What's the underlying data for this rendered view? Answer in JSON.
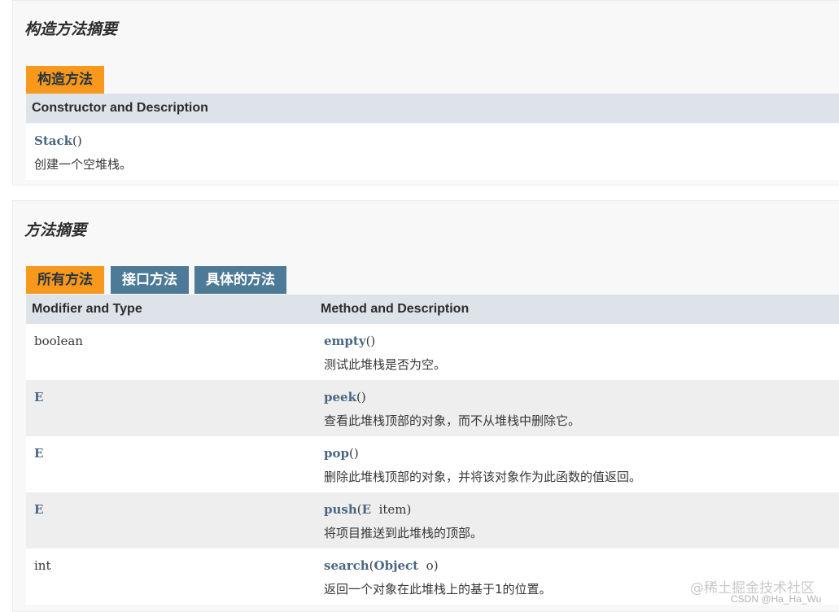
{
  "constructor_summary": {
    "title": "构造方法摘要",
    "tab_label": "构造方法",
    "header": "Constructor and Description",
    "rows": [
      {
        "name": "Stack",
        "params": "()",
        "description": "创建一个空堆栈。"
      }
    ]
  },
  "method_summary": {
    "title": "方法摘要",
    "tabs": [
      {
        "label": "所有方法",
        "active": true
      },
      {
        "label": "接口方法",
        "active": false
      },
      {
        "label": "具体的方法",
        "active": false
      }
    ],
    "headers": {
      "modifier_type": "Modifier and Type",
      "method_description": "Method and Description"
    },
    "rows": [
      {
        "type": "boolean",
        "name": "empty",
        "open": "(",
        "param_type": "",
        "param_name": "",
        "close": ")",
        "description": "测试此堆栈是否为空。"
      },
      {
        "type": "E",
        "name": "peek",
        "open": "(",
        "param_type": "",
        "param_name": "",
        "close": ")",
        "description": "查看此堆栈顶部的对象，而不从堆栈中删除它。"
      },
      {
        "type": "E",
        "name": "pop",
        "open": "(",
        "param_type": "",
        "param_name": "",
        "close": ")",
        "description": "删除此堆栈顶部的对象，并将该对象作为此函数的值返回。"
      },
      {
        "type": "E",
        "name": "push",
        "open": "(",
        "param_type": "E",
        "param_name": "  item",
        "close": ")",
        "description": "将项目推送到此堆栈的顶部。"
      },
      {
        "type": "int",
        "name": "search",
        "open": "(",
        "param_type": "Object",
        "param_name": "  o",
        "close": ")",
        "description": "返回一个对象在此堆栈上的基于1的位置。"
      }
    ]
  },
  "watermark": {
    "main": "@稀土掘金技术社区",
    "sub": "CSDN @Ha_Ha_Wu"
  },
  "colors": {
    "active_tab": "#f8981d",
    "inactive_tab": "#4d7a97",
    "header_bg": "#dee3e9",
    "alt_row_bg": "#eeeeef",
    "link": "#4a6782"
  }
}
